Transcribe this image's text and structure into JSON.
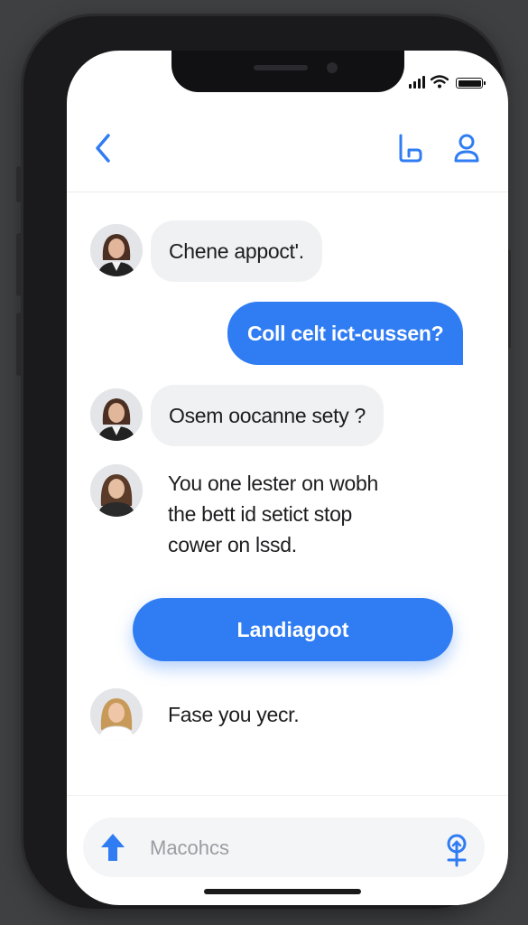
{
  "header": {
    "back_icon": "chevron-left-icon",
    "action_icons": [
      "hook-icon",
      "user-icon"
    ]
  },
  "messages": [
    {
      "side": "incoming",
      "text": "Chene appoct'."
    },
    {
      "side": "outgoing",
      "text": "Coll celt ict-cussen?"
    },
    {
      "side": "incoming",
      "text": "Osem oocanne sety ?"
    },
    {
      "side": "incoming",
      "lines": [
        "You one lester on wobh",
        "the bett id setict stop",
        "cower on lssd."
      ]
    },
    {
      "side": "action",
      "text": "Landiagoot"
    },
    {
      "side": "incoming",
      "text": "Fase you yecr."
    }
  ],
  "composer": {
    "placeholder": "Macohcs",
    "send_icon": "arrow-up-icon",
    "mic_icon": "microphone-icon"
  },
  "colors": {
    "accent": "#2f7cf3",
    "incoming_bubble": "#f0f1f3",
    "background": "#ffffff"
  }
}
